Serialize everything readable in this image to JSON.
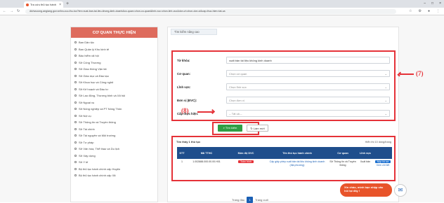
{
  "browser": {
    "tab_title": "Tra cứu thủ tục hành",
    "url": "dichvucong.angiang.gov.vn/tra-cuu-thu-tuc?ten=xuat-ban-tai-lieu-khong-kinh-doanh&co-quan=chon-co-quan&linh-vuc=chon-linh-vuc&don-vi=chon-don-vi&cap-thuc-hien=tat-ca"
  },
  "left_panel": {
    "title": "CƠ QUAN THỰC HIỆN",
    "items": [
      "Ban Dân tộc",
      "Ban Quản lý Khu kinh tế",
      "Bảo hiểm xã hội",
      "Sở Công Thương",
      "Sở Giao thông Vận tải",
      "Sở Giáo dục và Đào tạo",
      "Sở Khoa học và Công nghệ",
      "Sở Kế hoạch và Đầu tư",
      "Sở Lao động, Thương binh và Xã hội",
      "Sở Ngoại vụ",
      "Sở Nông nghiệp và PT Nông Thôn",
      "Sở Nội vụ",
      "Sở Thông tin và Truyền thông",
      "Sở Tài chính",
      "Sở Tài nguyên và Môi trường",
      "Sở Tư pháp",
      "Sở Văn hóa, Thể thao và Du lịch",
      "Sở Xây dựng",
      "Sở Y tế",
      "Bộ thủ tục hành chính cấp Huyện",
      "Bộ thủ tục hành chính cấp Xã"
    ]
  },
  "search": {
    "tab_label": "Tìm kiếm nâng cao",
    "fields": [
      {
        "label": "Từ khóa:",
        "value": "xuất bản tài liệu không kinh doanh",
        "dropdown": false
      },
      {
        "label": "Cơ quan:",
        "value": "Chọn cơ quan",
        "dropdown": true
      },
      {
        "label": "Lĩnh vực:",
        "value": "Chọn lĩnh vực",
        "dropdown": true
      },
      {
        "label": "Đơn vị (ĐVC):",
        "value": "Chọn đơn vị",
        "dropdown": true
      },
      {
        "label": "Cấp thực hiện:",
        "value": "-- Tất cả --",
        "dropdown": true
      }
    ],
    "search_button": "Tìm kiếm",
    "clear_button": "Làm mới"
  },
  "results": {
    "found_text": "Tìm thấy 1 thủ tục",
    "page_size_text": "Hiển thị 10 dòng/trang",
    "columns": [
      "STT",
      "Mã TTHC",
      "Mức độ DVC",
      "Tên thủ tục hành chính",
      "Cơ quan",
      "Lĩnh vực",
      ""
    ],
    "rows": [
      {
        "stt": "1",
        "code": "1.002888.000.00.00.H01",
        "level": "Toàn trình",
        "name": "Cấp giấy phép xuất bản tài liệu không kinh doanh (địa phương)",
        "agency": "Sở Thông tin và Truyền thông",
        "field": "Xuất bản",
        "action_primary": "Nộp hồ sơ",
        "action_secondary": "Xem chi tiết"
      }
    ]
  },
  "pagination": {
    "prev": "Trang đầu",
    "current": "1",
    "next": "Trang cuối"
  },
  "chat": {
    "text": "Xin chào, mình bạn nhập câu hỏi tại đây !"
  },
  "annotations": {
    "label_7": "(7)",
    "label_8": "(8)"
  },
  "colors": {
    "accent": "#e53238",
    "header": "#1f4e8c",
    "title_bar": "#de6b5d",
    "search_button": "#2f9e44"
  }
}
